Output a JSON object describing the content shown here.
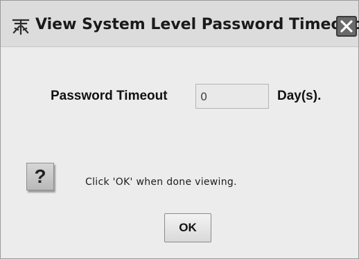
{
  "window": {
    "title": "View System Level Password Timeout",
    "icon": "app-logo-icon",
    "close_icon": "close-icon"
  },
  "form": {
    "timeout_label": "Password Timeout",
    "timeout_value": "0",
    "unit_label": "Day(s)."
  },
  "message": {
    "icon": "question-icon",
    "icon_glyph": "?",
    "text": "Click 'OK' when done viewing."
  },
  "buttons": {
    "ok_label": "OK"
  }
}
